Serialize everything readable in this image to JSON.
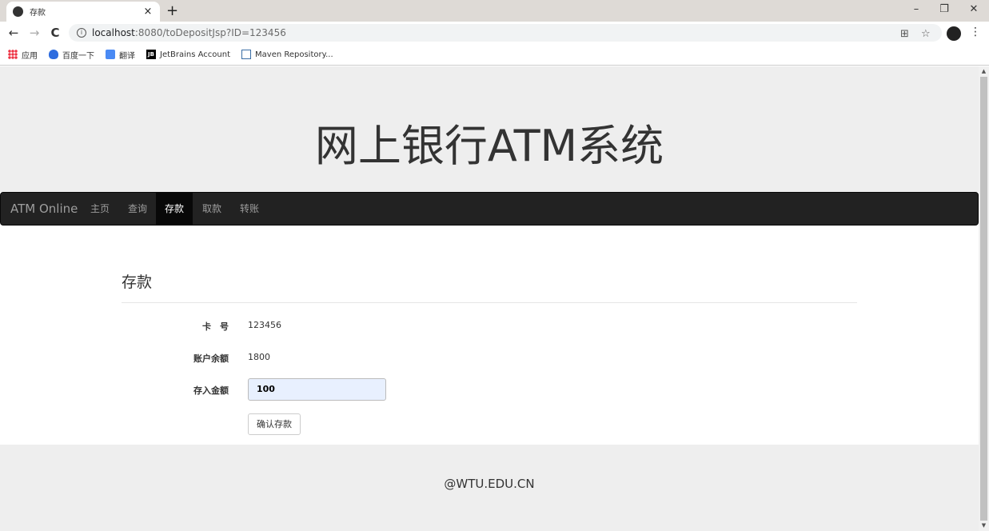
{
  "browser": {
    "tab_title": "存款",
    "tab_close": "×",
    "new_tab": "+",
    "url_host": "localhost",
    "url_path": ":8080/toDepositJsp?ID=123456",
    "back": "←",
    "forward": "→",
    "reload": "C",
    "info": "i",
    "translate": "⊞",
    "star": "☆",
    "menu": "⋮",
    "minimize": "–",
    "restore": "❐",
    "close": "✕",
    "bookmarks": [
      {
        "label": "应用",
        "icon": "apps-icon"
      },
      {
        "label": "百度一下",
        "icon": "baidu-icon"
      },
      {
        "label": "翻译",
        "icon": "translate-icon"
      },
      {
        "label": "JetBrains Account",
        "icon": "jetbrains-icon",
        "badge": "JB"
      },
      {
        "label": "Maven Repository...",
        "icon": "maven-icon"
      }
    ]
  },
  "header": {
    "title": "网上银行ATM系统"
  },
  "navbar": {
    "brand": "ATM Online",
    "items": [
      {
        "label": "主页",
        "active": false
      },
      {
        "label": "查询",
        "active": false
      },
      {
        "label": "存款",
        "active": true
      },
      {
        "label": "取款",
        "active": false
      },
      {
        "label": "转账",
        "active": false
      }
    ]
  },
  "form": {
    "legend": "存款",
    "card_label": "卡　号",
    "card_value": "123456",
    "balance_label": "账户余额",
    "balance_value": "1800",
    "amount_label": "存入金额",
    "amount_value": "100",
    "submit_label": "确认存款"
  },
  "footer": {
    "text": "@WTU.EDU.CN"
  },
  "colors": {
    "navbar_bg": "#222222",
    "jumbotron_bg": "#eeeeee",
    "input_autofill": "#e8f0fe"
  }
}
